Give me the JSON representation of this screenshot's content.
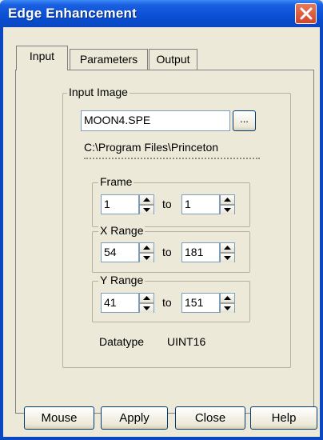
{
  "window": {
    "title": "Edge Enhancement"
  },
  "tabs": [
    {
      "label": "Input"
    },
    {
      "label": "Parameters"
    },
    {
      "label": "Output"
    }
  ],
  "input_image": {
    "group_label": "Input Image",
    "filename": "MOON4.SPE",
    "browse_label": "...",
    "path": "C:\\Program Files\\Princeton"
  },
  "frame": {
    "label": "Frame",
    "from": "1",
    "to_label": "to",
    "to": "1"
  },
  "x_range": {
    "label": "X Range",
    "from": "54",
    "to_label": "to",
    "to": "181"
  },
  "y_range": {
    "label": "Y Range",
    "from": "41",
    "to_label": "to",
    "to": "151"
  },
  "datatype": {
    "label": "Datatype",
    "value": "UINT16"
  },
  "buttons": {
    "mouse": "Mouse",
    "apply": "Apply",
    "close": "Close",
    "help": "Help"
  },
  "colors": {
    "title_bar": "#0a4fd4",
    "close_button": "#d1462a",
    "dialog_bg": "#ece9d8"
  }
}
